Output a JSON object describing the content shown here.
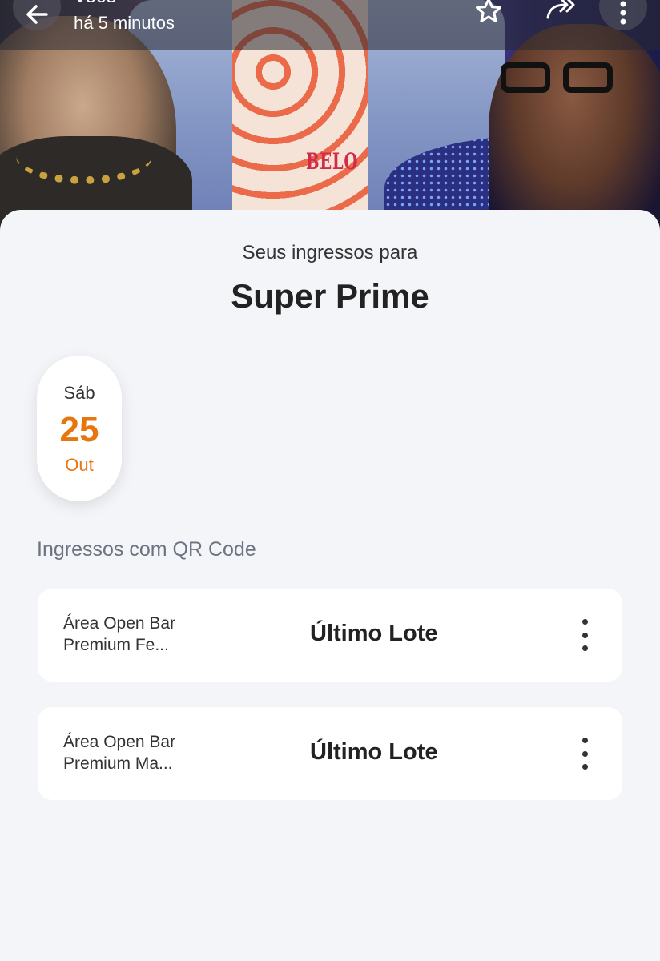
{
  "header": {
    "sender": "Você",
    "time": "há 5 minutos"
  },
  "banner": {
    "logo_text": "BELO"
  },
  "event": {
    "subtitle": "Seus ingressos para",
    "title": "Super Prime",
    "date": {
      "weekday": "Sáb",
      "day": "25",
      "month": "Out"
    }
  },
  "tickets_section": {
    "label": "Ingressos com QR Code",
    "items": [
      {
        "name_line1": "Área Open Bar",
        "name_line2": "Premium Fe...",
        "lot": "Último Lote"
      },
      {
        "name_line1": "Área Open Bar",
        "name_line2": "Premium Ma...",
        "lot": "Último Lote"
      }
    ]
  },
  "icons": {
    "back": "arrow-left-icon",
    "star": "star-icon",
    "share": "forward-icon",
    "more": "more-vertical-icon",
    "ticket_menu": "more-vertical-icon"
  },
  "colors": {
    "accent": "#e8760f",
    "background": "#f4f5f8",
    "card": "#ffffff"
  }
}
